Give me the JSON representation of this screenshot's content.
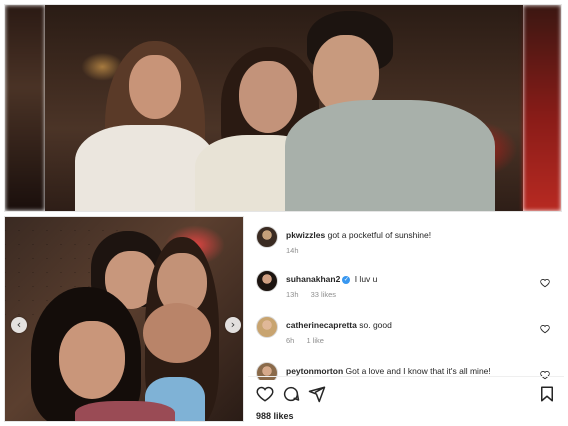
{
  "comments": [
    {
      "user": "pkwizzles",
      "text": "got a pocketful of sunshine!",
      "time": "14h",
      "likes": "",
      "verified": false
    },
    {
      "user": "suhanakhan2",
      "text": "I luv u",
      "time": "13h",
      "likes": "33 likes",
      "verified": true
    },
    {
      "user": "catherinecapretta",
      "text": "so. good",
      "time": "6h",
      "likes": "1 like",
      "verified": false
    },
    {
      "user": "peytonmorton",
      "text": "Got a love and I know that it's all mine!",
      "time": "",
      "likes": "",
      "verified": false
    }
  ],
  "post": {
    "likes": "988 likes"
  },
  "carousel": {
    "prev_glyph": "‹",
    "next_glyph": "›"
  },
  "colors": {
    "verified": "#3897f0",
    "meta_text": "#8e8e8e",
    "text": "#262626"
  },
  "icons": {
    "actions": [
      "heart-icon",
      "comment-icon",
      "share-icon",
      "bookmark-icon"
    ],
    "comment_like": "heart-outline-icon"
  }
}
